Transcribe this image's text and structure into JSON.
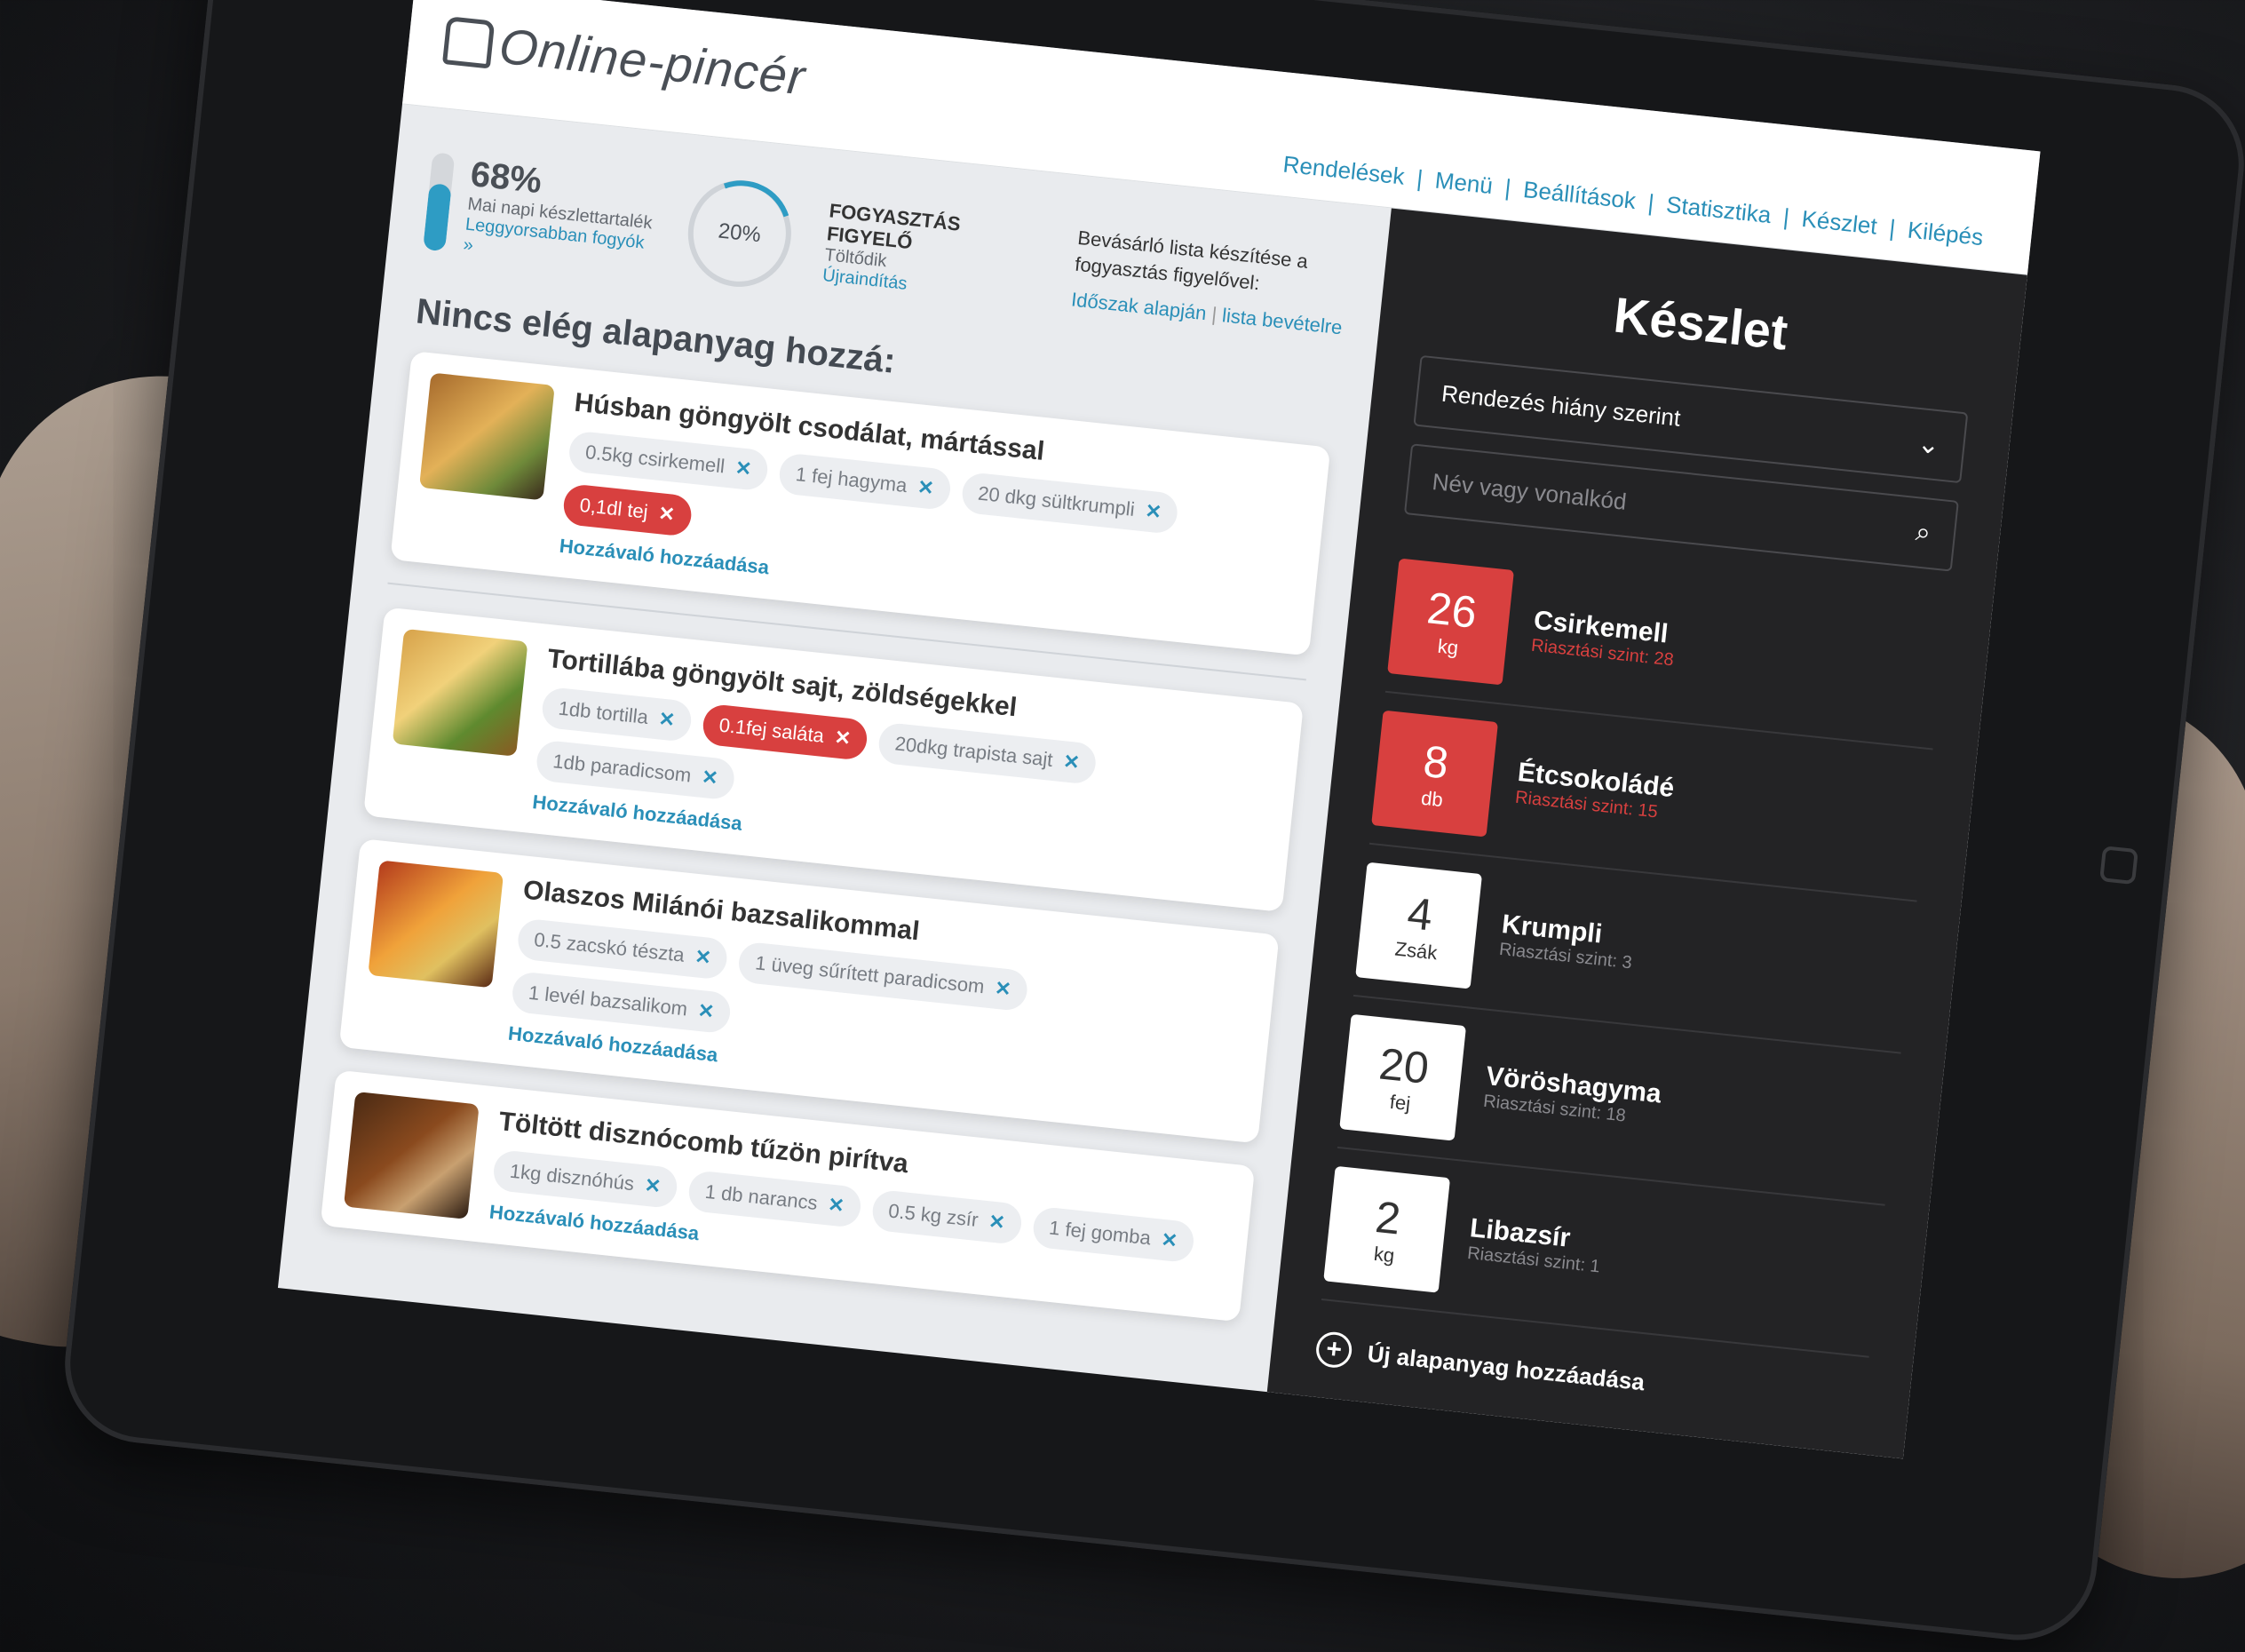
{
  "logo_text": "Online-pincér",
  "nav": {
    "items": [
      "Rendelések",
      "Menü",
      "Beállítások",
      "Statisztika",
      "Készlet",
      "Kilépés"
    ]
  },
  "stats": {
    "stock_level_percent": "68%",
    "stock_level_fill": 0.68,
    "stock_level_label": "Mai napi készlettartalék",
    "fastest_link": "Leggyorsabban fogyók »",
    "consumption_percent": "20%",
    "consumption_title": "FOGYASZTÁS FIGYELŐ",
    "consumption_status": "Töltődik",
    "restart_link": "Újraindítás",
    "shopping_text": "Bevásárló lista készítése a fogyasztás figyelővel:",
    "shopping_link1": "Időszak alapján",
    "shopping_link2": "lista bevételre"
  },
  "section_title": "Nincs elég alapanyag hozzá:",
  "add_ingredient": "Hozzávaló hozzáadása",
  "dishes": [
    {
      "name": "Húsban göngyölt csodálat, mártással",
      "ingredients": [
        {
          "label": "0.5kg csirkemell",
          "missing": false
        },
        {
          "label": "1 fej hagyma",
          "missing": false
        },
        {
          "label": "20 dkg sültkrumpli",
          "missing": false
        },
        {
          "label": "0,1dl tej",
          "missing": true
        }
      ]
    },
    {
      "name": "Tortillába göngyölt sajt, zöldségekkel",
      "ingredients": [
        {
          "label": "1db tortilla",
          "missing": false
        },
        {
          "label": "0.1fej saláta",
          "missing": true
        },
        {
          "label": "20dkg trapista sajt",
          "missing": false
        },
        {
          "label": "1db paradicsom",
          "missing": false
        }
      ]
    },
    {
      "name": "Olaszos Milánói bazsalikommal",
      "ingredients": [
        {
          "label": "0.5 zacskó tészta",
          "missing": false
        },
        {
          "label": "1 üveg sűrített paradicsom",
          "missing": false
        },
        {
          "label": "1 levél bazsalikom",
          "missing": false
        }
      ]
    },
    {
      "name": "Töltött disznócomb tűzön pirítva",
      "ingredients": [
        {
          "label": "1kg disznóhús",
          "missing": false
        },
        {
          "label": "1 db narancs",
          "missing": false
        },
        {
          "label": "0.5 kg zsír",
          "missing": false
        },
        {
          "label": "1 fej gomba",
          "missing": false
        }
      ]
    }
  ],
  "side": {
    "title": "Készlet",
    "sort_select": "Rendezés hiány szerint",
    "search_placeholder": "Név vagy vonalkód",
    "items": [
      {
        "qty": "26",
        "unit": "kg",
        "name": "Csirkemell",
        "alert": "Riasztási szint: 28",
        "low": true
      },
      {
        "qty": "8",
        "unit": "db",
        "name": "Étcsokoládé",
        "alert": "Riasztási szint: 15",
        "low": true
      },
      {
        "qty": "4",
        "unit": "Zsák",
        "name": "Krumpli",
        "alert": "Riasztási szint: 3",
        "low": false
      },
      {
        "qty": "20",
        "unit": "fej",
        "name": "Vöröshagyma",
        "alert": "Riasztási szint: 18",
        "low": false
      },
      {
        "qty": "2",
        "unit": "kg",
        "name": "Libazsír",
        "alert": "Riasztási szint: 1",
        "low": false
      }
    ],
    "new_item": "Új alapanyag hozzáadása"
  },
  "colors": {
    "accent": "#2a8fb8",
    "alert": "#d8403f",
    "panel": "#232325"
  }
}
